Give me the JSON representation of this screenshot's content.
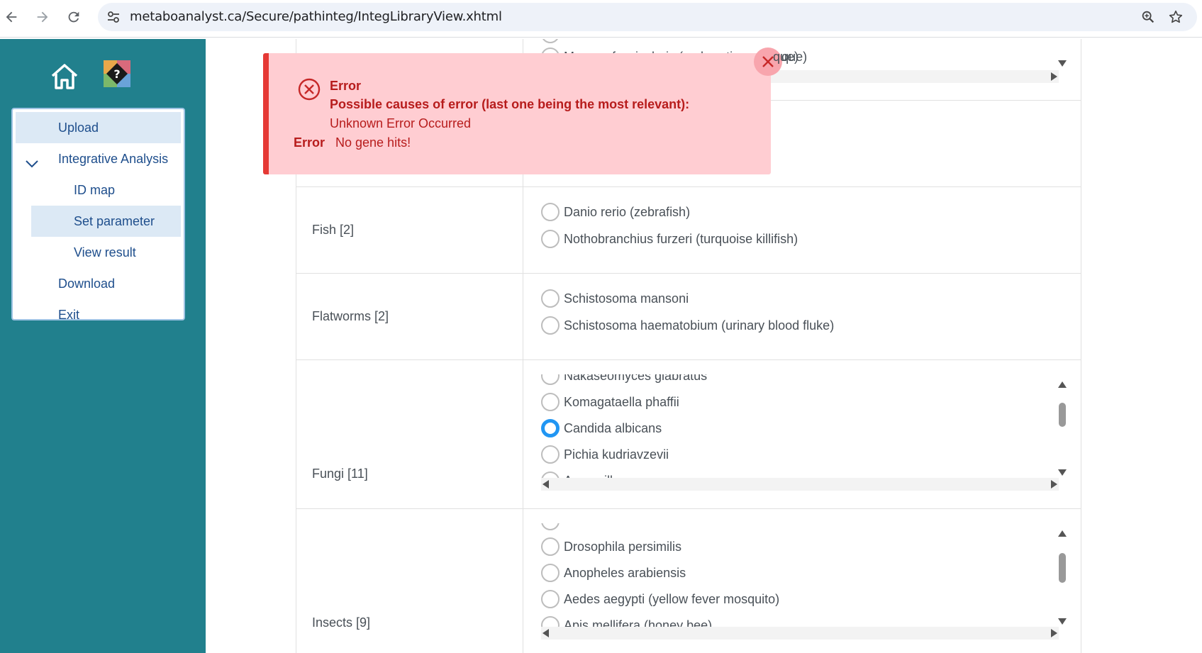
{
  "browser": {
    "url": "metaboanalyst.ca/Secure/pathinteg/IntegLibraryView.xhtml"
  },
  "sidebar": {
    "items": [
      {
        "label": "Upload"
      },
      {
        "label": "Integrative Analysis"
      },
      {
        "label": "ID map"
      },
      {
        "label": "Set parameter"
      },
      {
        "label": "View result"
      },
      {
        "label": "Download"
      },
      {
        "label": "Exit"
      }
    ]
  },
  "error": {
    "title": "Error",
    "line1": "Possible causes of error (last one being the most relevant):",
    "line2": "Unknown Error Occurred",
    "line3_label": "Error",
    "line3": "No gene hits!"
  },
  "table": {
    "top_partial_option": "Macaca fascicularis (crab-eating macaque)",
    "top_partial_tail": "que)",
    "rows": [
      {
        "category": "Fish [2]",
        "options": [
          "Danio rerio (zebrafish)",
          "Nothobranchius furzeri (turquoise killifish)"
        ]
      },
      {
        "category": "Flatworms [2]",
        "options": [
          "Schistosoma mansoni",
          "Schistosoma haematobium (urinary blood fluke)"
        ]
      },
      {
        "category": "Fungi [11]",
        "options": [
          "Nakaseomyces glabratus",
          "Komagataella phaffii",
          "Candida albicans",
          "Pichia kudriavzevii",
          "Aspergillus oryzae"
        ],
        "selected": "Candida albicans"
      },
      {
        "category": "Insects [9]",
        "options": [
          "Drosophila persimilis",
          "Anopheles arabiensis",
          "Aedes aegypti (yellow fever mosquito)",
          "Apis mellifera (honey bee)"
        ]
      }
    ]
  },
  "colors": {
    "sidebar_bg": "#21808d",
    "error_bg": "#ffcdd2",
    "error_border": "#e53935",
    "error_text": "#b71c1c",
    "radio_selected": "#2196f3"
  }
}
